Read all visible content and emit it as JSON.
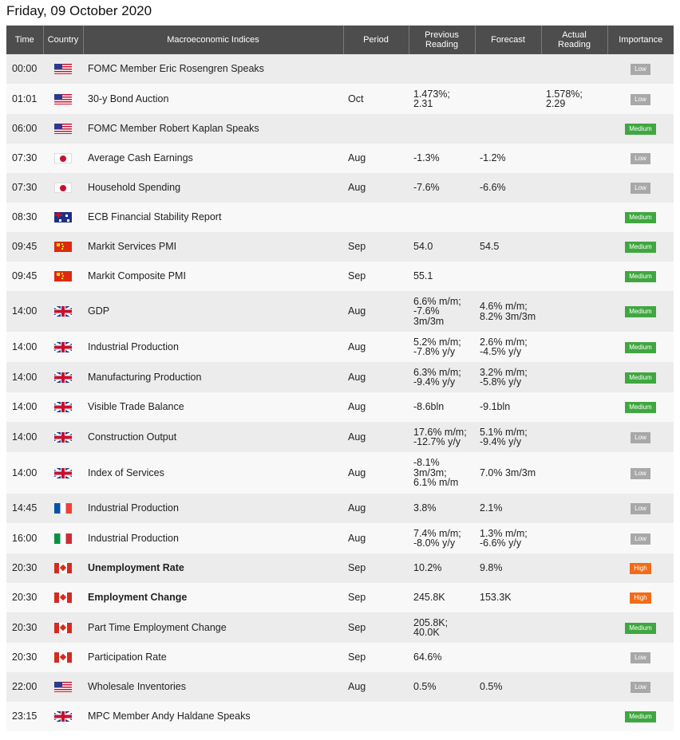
{
  "page_title": "Friday, 09 October 2020",
  "columns": [
    "Time",
    "Country",
    "Macroeconomic Indices",
    "Period",
    "Previous Reading",
    "Forecast",
    "Actual Reading",
    "Importance"
  ],
  "colors": {
    "header_bg": "#4d4d4d",
    "low": "#a8a8a8",
    "medium": "#3fa73f",
    "high": "#f26b18"
  },
  "rows": [
    {
      "time": "00:00",
      "country": "us",
      "flag_icon": "us-flag-icon",
      "indicator": "FOMC Member Eric Rosengren Speaks",
      "period": "",
      "previous": "",
      "forecast": "",
      "actual": "",
      "importance": "Low",
      "bold": false
    },
    {
      "time": "01:01",
      "country": "us",
      "flag_icon": "us-flag-icon",
      "indicator": "30-y Bond Auction",
      "period": "Oct",
      "previous": "1.473%;\n2.31",
      "forecast": "",
      "actual": "1.578%;\n2.29",
      "importance": "Low",
      "bold": false
    },
    {
      "time": "06:00",
      "country": "us",
      "flag_icon": "us-flag-icon",
      "indicator": "FOMC Member Robert Kaplan Speaks",
      "period": "",
      "previous": "",
      "forecast": "",
      "actual": "",
      "importance": "Medium",
      "bold": false
    },
    {
      "time": "07:30",
      "country": "jp",
      "flag_icon": "japan-flag-icon",
      "indicator": "Average Cash Earnings",
      "period": "Aug",
      "previous": "-1.3%",
      "forecast": "-1.2%",
      "actual": "",
      "importance": "Low",
      "bold": false
    },
    {
      "time": "07:30",
      "country": "jp",
      "flag_icon": "japan-flag-icon",
      "indicator": "Household Spending",
      "period": "Aug",
      "previous": "-7.6%",
      "forecast": "-6.6%",
      "actual": "",
      "importance": "Low",
      "bold": false
    },
    {
      "time": "08:30",
      "country": "au",
      "flag_icon": "australia-flag-icon",
      "indicator": "ECB Financial Stability Report",
      "period": "",
      "previous": "",
      "forecast": "",
      "actual": "",
      "importance": "Medium",
      "bold": false
    },
    {
      "time": "09:45",
      "country": "cn",
      "flag_icon": "china-flag-icon",
      "indicator": "Markit Services PMI",
      "period": "Sep",
      "previous": "54.0",
      "forecast": "54.5",
      "actual": "",
      "importance": "Medium",
      "bold": false
    },
    {
      "time": "09:45",
      "country": "cn",
      "flag_icon": "china-flag-icon",
      "indicator": "Markit Composite PMI",
      "period": "Sep",
      "previous": "55.1",
      "forecast": "",
      "actual": "",
      "importance": "Medium",
      "bold": false
    },
    {
      "time": "14:00",
      "country": "gb",
      "flag_icon": "uk-flag-icon",
      "indicator": "GDP",
      "period": "Aug",
      "previous": "6.6% m/m;\n-7.6%\n3m/3m",
      "forecast": "4.6% m/m;\n8.2% 3m/3m",
      "actual": "",
      "importance": "Medium",
      "bold": false
    },
    {
      "time": "14:00",
      "country": "gb",
      "flag_icon": "uk-flag-icon",
      "indicator": "Industrial Production",
      "period": "Aug",
      "previous": "5.2% m/m;\n-7.8% y/y",
      "forecast": "2.6% m/m;\n-4.5% y/y",
      "actual": "",
      "importance": "Medium",
      "bold": false
    },
    {
      "time": "14:00",
      "country": "gb",
      "flag_icon": "uk-flag-icon",
      "indicator": "Manufacturing Production",
      "period": "Aug",
      "previous": "6.3% m/m;\n-9.4% y/y",
      "forecast": "3.2% m/m;\n-5.8% y/y",
      "actual": "",
      "importance": "Medium",
      "bold": false
    },
    {
      "time": "14:00",
      "country": "gb",
      "flag_icon": "uk-flag-icon",
      "indicator": "Visible Trade Balance",
      "period": "Aug",
      "previous": "-8.6bln",
      "forecast": "-9.1bln",
      "actual": "",
      "importance": "Medium",
      "bold": false
    },
    {
      "time": "14:00",
      "country": "gb",
      "flag_icon": "uk-flag-icon",
      "indicator": "Construction Output",
      "period": "Aug",
      "previous": "17.6% m/m;\n-12.7% y/y",
      "forecast": "5.1% m/m;\n-9.4% y/y",
      "actual": "",
      "importance": "Low",
      "bold": false
    },
    {
      "time": "14:00",
      "country": "gb",
      "flag_icon": "uk-flag-icon",
      "indicator": "Index of Services",
      "period": "Aug",
      "previous": "-8.1%\n3m/3m;\n6.1% m/m",
      "forecast": "7.0% 3m/3m",
      "actual": "",
      "importance": "Low",
      "bold": false
    },
    {
      "time": "14:45",
      "country": "fr",
      "flag_icon": "france-flag-icon",
      "indicator": "Industrial Production",
      "period": "Aug",
      "previous": "3.8%",
      "forecast": "2.1%",
      "actual": "",
      "importance": "Low",
      "bold": false
    },
    {
      "time": "16:00",
      "country": "it",
      "flag_icon": "italy-flag-icon",
      "indicator": "Industrial Production",
      "period": "Aug",
      "previous": "7.4% m/m;\n-8.0% y/y",
      "forecast": "1.3% m/m;\n-6.6% y/y",
      "actual": "",
      "importance": "Low",
      "bold": false
    },
    {
      "time": "20:30",
      "country": "ca",
      "flag_icon": "canada-flag-icon",
      "indicator": "Unemployment Rate",
      "period": "Sep",
      "previous": "10.2%",
      "forecast": "9.8%",
      "actual": "",
      "importance": "High",
      "bold": true
    },
    {
      "time": "20:30",
      "country": "ca",
      "flag_icon": "canada-flag-icon",
      "indicator": "Employment Change",
      "period": "Sep",
      "previous": "245.8K",
      "forecast": "153.3K",
      "actual": "",
      "importance": "High",
      "bold": true
    },
    {
      "time": "20:30",
      "country": "ca",
      "flag_icon": "canada-flag-icon",
      "indicator": "Part Time Employment Change",
      "period": "Sep",
      "previous": "205.8K;\n40.0K",
      "forecast": "",
      "actual": "",
      "importance": "Medium",
      "bold": false
    },
    {
      "time": "20:30",
      "country": "ca",
      "flag_icon": "canada-flag-icon",
      "indicator": "Participation Rate",
      "period": "Sep",
      "previous": "64.6%",
      "forecast": "",
      "actual": "",
      "importance": "Low",
      "bold": false
    },
    {
      "time": "22:00",
      "country": "us",
      "flag_icon": "us-flag-icon",
      "indicator": "Wholesale Inventories",
      "period": "Aug",
      "previous": "0.5%",
      "forecast": "0.5%",
      "actual": "",
      "importance": "Low",
      "bold": false
    },
    {
      "time": "23:15",
      "country": "gb",
      "flag_icon": "uk-flag-icon",
      "indicator": "MPC Member Andy Haldane Speaks",
      "period": "",
      "previous": "",
      "forecast": "",
      "actual": "",
      "importance": "Medium",
      "bold": false
    }
  ]
}
